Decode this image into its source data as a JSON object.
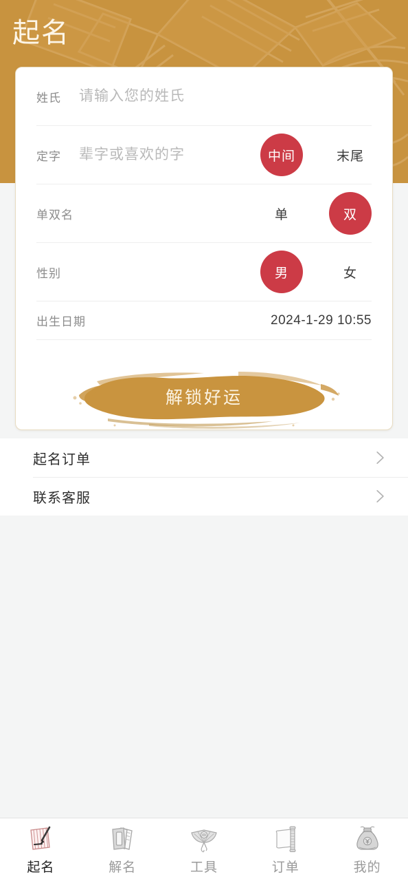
{
  "header": {
    "title": "起名",
    "background_color": "#c8933f",
    "title_color": "#fdf6e8"
  },
  "theme": {
    "accent_gold": "#c8933f",
    "accent_red": "#cc3b46",
    "page_background": "#f4f5f5",
    "card_background": "#ffffff"
  },
  "form": {
    "rows": [
      {
        "label": "姓氏",
        "placeholder": "请输入您的姓氏",
        "value": "",
        "type": "text-input"
      },
      {
        "label": "定字",
        "placeholder": "辈字或喜欢的字",
        "value": "",
        "type": "text-input-with-options",
        "options": [
          {
            "label": "中间",
            "selected": true
          },
          {
            "label": "末尾",
            "selected": false
          }
        ]
      },
      {
        "label": "单双名",
        "type": "options",
        "options": [
          {
            "label": "单",
            "selected": false
          },
          {
            "label": "双",
            "selected": true
          }
        ]
      },
      {
        "label": "性别",
        "type": "options",
        "options": [
          {
            "label": "男",
            "selected": true
          },
          {
            "label": "女",
            "selected": false
          }
        ]
      },
      {
        "label": "出生日期",
        "type": "date",
        "value": "2024-1-29 10:55"
      }
    ],
    "cta_label": "解锁好运"
  },
  "menu": {
    "items": [
      {
        "label": "起名订单",
        "chevron": "chevron-right-icon"
      },
      {
        "label": "联系客服",
        "chevron": "chevron-right-icon"
      }
    ]
  },
  "bottom_nav": {
    "items": [
      {
        "label": "起名",
        "icon": "scroll-brush-icon",
        "active": true
      },
      {
        "label": "解名",
        "icon": "books-icon",
        "active": false
      },
      {
        "label": "工具",
        "icon": "folding-fan-icon",
        "active": false
      },
      {
        "label": "订单",
        "icon": "paper-scroll-icon",
        "active": false
      },
      {
        "label": "我的",
        "icon": "money-bag-icon",
        "active": false
      }
    ]
  }
}
